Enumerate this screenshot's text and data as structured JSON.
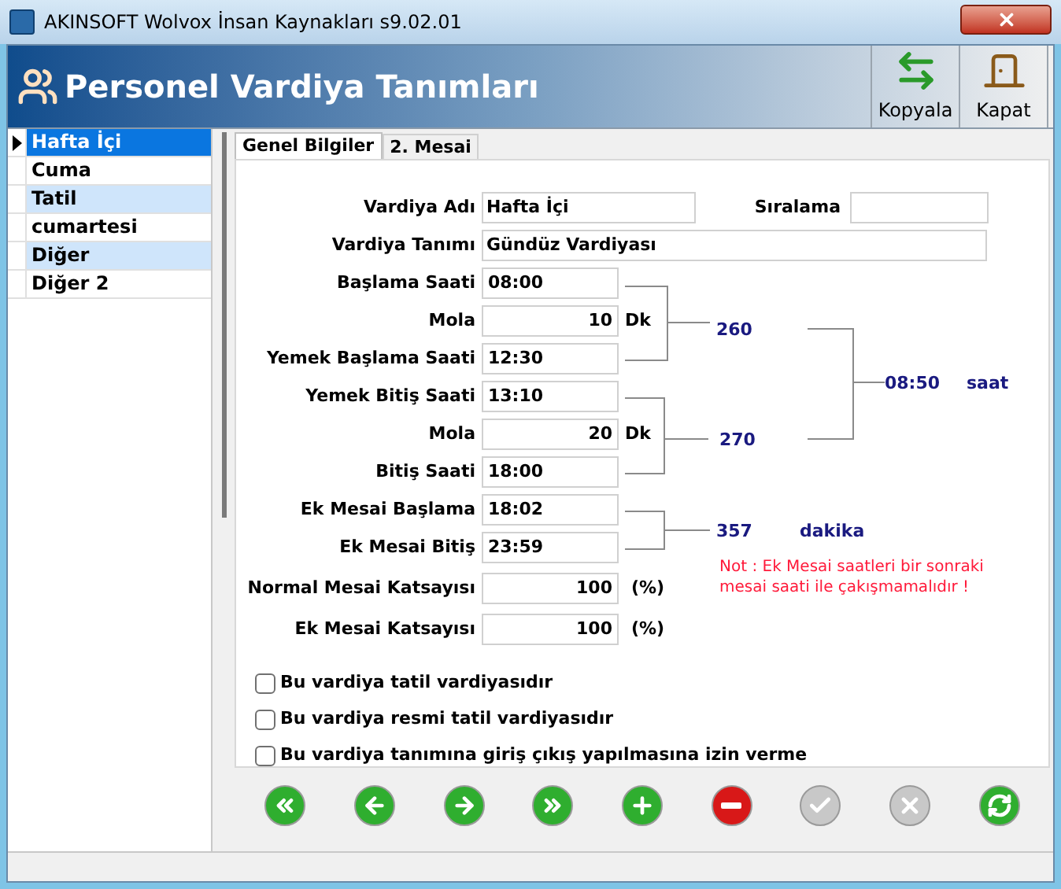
{
  "window": {
    "title": "AKINSOFT Wolvox İnsan Kaynakları s9.02.01"
  },
  "header": {
    "title": "Personel Vardiya Tanımları"
  },
  "toolbar": [
    {
      "label": "Kopyala",
      "kind": "copy"
    },
    {
      "label": "Kapat",
      "kind": "close"
    }
  ],
  "shifts": [
    {
      "name": "Hafta İçi",
      "selected": true
    },
    {
      "name": "Cuma",
      "selected": false
    },
    {
      "name": "Tatil",
      "selected": false
    },
    {
      "name": "cumartesi",
      "selected": false
    },
    {
      "name": "Diğer",
      "selected": false
    },
    {
      "name": "Diğer 2",
      "selected": false
    }
  ],
  "tabs": [
    {
      "label": "Genel Bilgiler",
      "selected": true
    },
    {
      "label": "2. Mesai",
      "selected": false
    }
  ],
  "name_field": {
    "label": "Vardiya Adı",
    "value": "Hafta İçi"
  },
  "order_field": {
    "label": "Sıralama"
  },
  "description_field": {
    "label": "Vardiya Tanımı",
    "value": "Gündüz Vardiyası"
  },
  "fields": [
    {
      "label": "Başlama Saati",
      "value": "08:00",
      "kind": "time"
    },
    {
      "label": "Mola",
      "value": "10",
      "kind": "number",
      "unit": "Dk"
    },
    {
      "label": "Yemek Başlama Saati",
      "value": "12:30",
      "kind": "time"
    },
    {
      "label": "Yemek Bitiş Saati",
      "value": "13:10",
      "kind": "time"
    },
    {
      "label": "Mola",
      "value": "20",
      "kind": "number",
      "unit": "Dk"
    },
    {
      "label": "Bitiş Saati",
      "value": "18:00",
      "kind": "time"
    },
    {
      "label": "Ek Mesai Başlama",
      "value": "18:02",
      "kind": "time"
    },
    {
      "label": "Ek Mesai Bitiş",
      "value": "23:59",
      "kind": "time"
    },
    {
      "label": "Normal Mesai Katsayısı",
      "value": "100",
      "kind": "number",
      "unit": "(%)"
    },
    {
      "label": "Ek Mesai Katsayısı",
      "value": "100",
      "kind": "number",
      "unit": "(%)"
    }
  ],
  "totals": {
    "first_part": "260",
    "second_part": "270",
    "sum": "08:50",
    "sum_unit": "saat",
    "overtime": "357",
    "overtime_unit": "dakika"
  },
  "note": "Not : Ek Mesai saatleri bir sonraki mesai saati ile çakışmamalıdır !",
  "options": [
    {
      "label": "Bu vardiya tatil vardiyasıdır",
      "checked": false
    },
    {
      "label": "Bu vardiya resmi tatil vardiyasıdır",
      "checked": false
    },
    {
      "label": "Bu vardiya tanımına giriş çıkış yapılmasına izin verme",
      "checked": false
    }
  ],
  "nav_buttons": [
    {
      "kind": "first",
      "disabled": false
    },
    {
      "kind": "previous",
      "disabled": false
    },
    {
      "kind": "next",
      "disabled": false
    },
    {
      "kind": "last",
      "disabled": false
    },
    {
      "kind": "add",
      "disabled": false
    },
    {
      "kind": "delete",
      "disabled": false
    },
    {
      "kind": "save",
      "disabled": true
    },
    {
      "kind": "cancel",
      "disabled": true
    },
    {
      "kind": "refresh",
      "disabled": false
    }
  ]
}
